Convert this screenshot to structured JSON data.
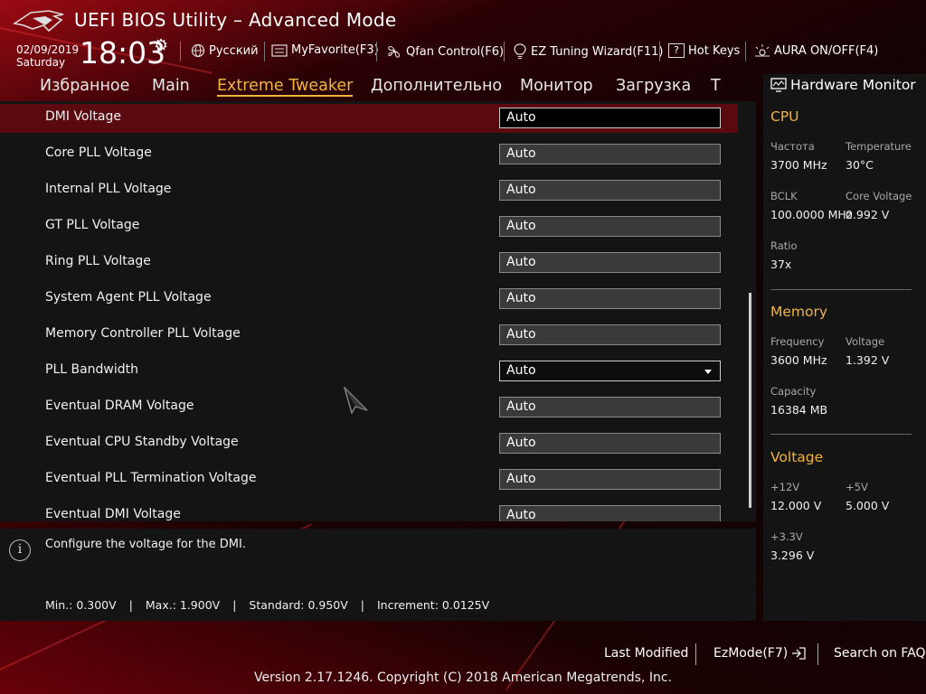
{
  "header": {
    "title": "UEFI BIOS Utility – Advanced Mode",
    "date": "02/09/2019",
    "day": "Saturday",
    "time": "18:03",
    "items": [
      {
        "icon": "globe-icon",
        "label": "Русский"
      },
      {
        "icon": "favorite-icon",
        "label": "MyFavorite(F3)"
      },
      {
        "icon": "fan-icon",
        "label": "Qfan Control(F6)"
      },
      {
        "icon": "lightbulb-icon",
        "label": "EZ Tuning Wizard(F11)"
      },
      {
        "icon": "hotkeys-icon",
        "label": "Hot Keys"
      },
      {
        "icon": "aura-icon",
        "label": "AURA ON/OFF(F4)"
      }
    ]
  },
  "tabs": [
    "Избранное",
    "Main",
    "Extreme Tweaker",
    "Дополнительно",
    "Монитор",
    "Загрузка",
    "T"
  ],
  "active_tab": "Extreme Tweaker",
  "settings": [
    {
      "label": "DMI Voltage",
      "value": "Auto",
      "selected": true
    },
    {
      "label": "Core PLL Voltage",
      "value": "Auto"
    },
    {
      "label": "Internal PLL Voltage",
      "value": "Auto"
    },
    {
      "label": "GT PLL Voltage",
      "value": "Auto"
    },
    {
      "label": "Ring PLL Voltage",
      "value": "Auto"
    },
    {
      "label": "System Agent PLL Voltage",
      "value": "Auto"
    },
    {
      "label": "Memory Controller PLL Voltage",
      "value": "Auto"
    },
    {
      "label": "PLL Bandwidth",
      "value": "Auto",
      "dropdown": true
    },
    {
      "label": "Eventual DRAM Voltage",
      "value": "Auto"
    },
    {
      "label": "Eventual CPU Standby Voltage",
      "value": "Auto"
    },
    {
      "label": "Eventual PLL Termination Voltage",
      "value": "Auto"
    },
    {
      "label": "Eventual DMI Voltage",
      "value": "Auto"
    }
  ],
  "help": {
    "text": "Configure the voltage for the DMI.",
    "min": "Min.: 0.300V",
    "max": "Max.: 1.900V",
    "standard": "Standard: 0.950V",
    "increment": "Increment: 0.0125V",
    "separator": "|"
  },
  "hardware_monitor": {
    "title": "Hardware Monitor",
    "cpu": {
      "heading": "CPU",
      "freq_label": "Частота",
      "freq": "3700 MHz",
      "temp_label": "Temperature",
      "temp": "30°C",
      "bclk_label": "BCLK",
      "bclk": "100.0000 MHz",
      "core_v_label": "Core Voltage",
      "core_v": "0.992 V",
      "ratio_label": "Ratio",
      "ratio": "37x"
    },
    "memory": {
      "heading": "Memory",
      "freq_label": "Frequency",
      "freq": "3600 MHz",
      "volt_label": "Voltage",
      "volt": "1.392 V",
      "cap_label": "Capacity",
      "cap": "16384 MB"
    },
    "voltage": {
      "heading": "Voltage",
      "v12_label": "+12V",
      "v12": "12.000 V",
      "v5_label": "+5V",
      "v5": "5.000 V",
      "v33_label": "+3.3V",
      "v33": "3.296 V"
    }
  },
  "footer": {
    "last_modified": "Last Modified",
    "ezmode": "EzMode(F7)",
    "search": "Search on FAQ",
    "copyright": "Version 2.17.1246. Copyright (C) 2018 American Megatrends, Inc."
  },
  "colors": {
    "accent": "#f2b441",
    "selected_row": "#5a0a0e"
  }
}
